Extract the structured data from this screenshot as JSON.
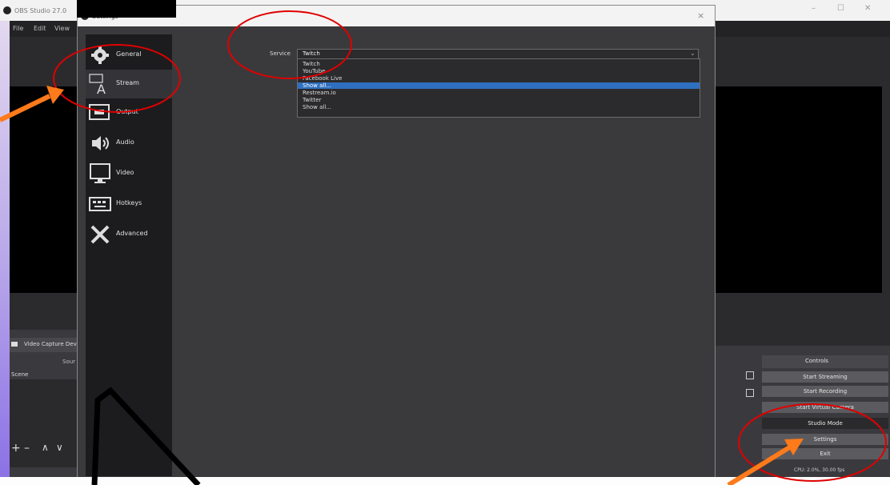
{
  "app": {
    "title": "OBS Studio 27.0",
    "menu": [
      "File",
      "Edit",
      "View"
    ]
  },
  "settings_dialog": {
    "title": "Settings",
    "close_label": "×",
    "sidebar": [
      {
        "label": "General",
        "icon": "gear-icon"
      },
      {
        "label": "Stream",
        "icon": "stream-icon"
      },
      {
        "label": "Output",
        "icon": "output-icon"
      },
      {
        "label": "Audio",
        "icon": "speaker-icon"
      },
      {
        "label": "Video",
        "icon": "monitor-icon"
      },
      {
        "label": "Hotkeys",
        "icon": "keyboard-icon"
      },
      {
        "label": "Advanced",
        "icon": "tools-icon"
      }
    ],
    "service": {
      "label": "Service",
      "selected": "Twitch",
      "options": [
        "Twitch",
        "YouTube",
        "Facebook Live",
        "Show all...",
        "Restream.io",
        "Twitter",
        "Show all..."
      ]
    }
  },
  "scenes": {
    "title": "Scene",
    "source_title": "Video Capture Device",
    "source_label": "Sour"
  },
  "controls": {
    "title": "Controls",
    "buttons": [
      "Start Streaming",
      "Start Recording",
      "Start Virtual Camera",
      "Studio Mode",
      "Settings",
      "Exit"
    ]
  },
  "status": {
    "cpu": "CPU: 2.0%, 30.00 fps"
  },
  "colors": {
    "annotation_circle": "#e00000",
    "annotation_arrow": "#ff7a1a",
    "highlight": "#2e6fbf"
  }
}
